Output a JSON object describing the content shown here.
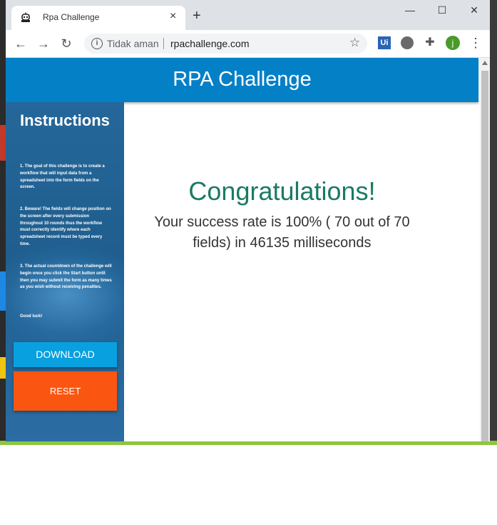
{
  "browser": {
    "tab_title": "Rpa Challenge",
    "tab_close": "×",
    "new_tab": "+",
    "security_label": "Tidak aman",
    "url": "rpachallenge.com",
    "avatar_initial": "j",
    "ext_ui_label": "Ui",
    "window_min": "—",
    "window_max": "☐",
    "window_close": "✕"
  },
  "site": {
    "title": "RPA Challenge"
  },
  "sidebar": {
    "heading": "Instructions",
    "paragraphs": [
      "1. The goal of this challenge is to create a workflow that will input data from a spreadsheet into the form fields on the screen.",
      "2. Beware! The fields will change position on the screen after every submission throughout 10 rounds thus the workflow must correctly identify where each spreadsheet record must be typed every time.",
      "3. The actual countdown of the challenge will begin once you click the Start button until then you may submit the form as many times as you wish without receiving penalties.",
      "Good luck!"
    ],
    "download_label": "DOWNLOAD",
    "reset_label": "RESET"
  },
  "main": {
    "congrats": "Congratulations!",
    "result": "Your success rate is 100% ( 70 out of 70 fields) in 46135 milliseconds"
  },
  "colors": {
    "header_blue": "#0480c7",
    "download_blue": "#09a0e0",
    "reset_orange": "#fb5611",
    "congrats_green": "#1b7a63",
    "taskbar_green": "#8cc63f"
  }
}
